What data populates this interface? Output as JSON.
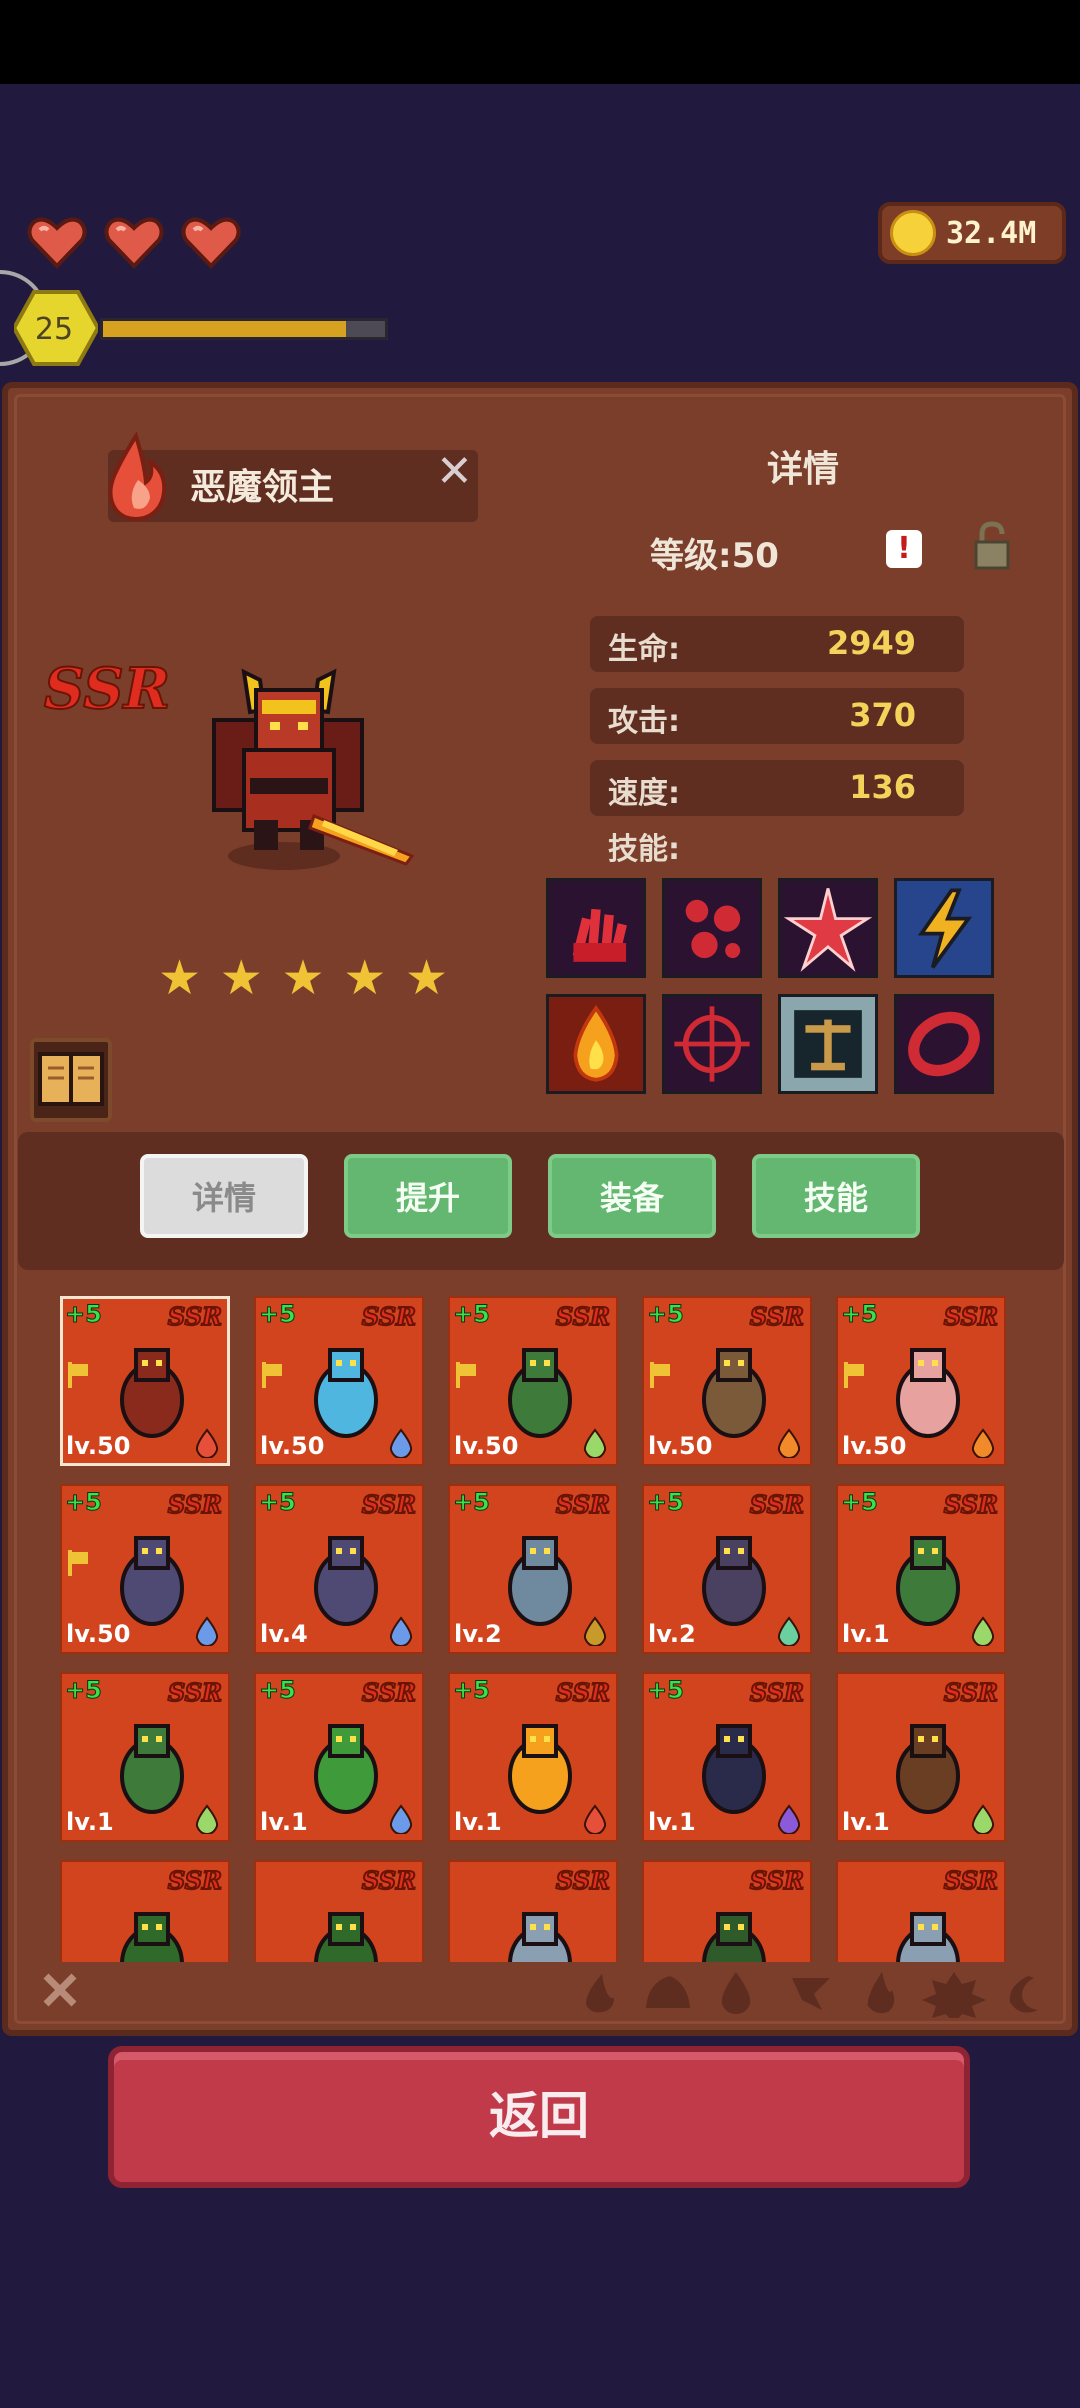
{
  "hud": {
    "hearts": 3,
    "coins": "32.4M",
    "player_level": "25",
    "xp_progress": 0.86
  },
  "hero": {
    "name": "恶魔领主",
    "rarity": "SSR",
    "stars": 5,
    "element": "fire"
  },
  "details": {
    "title": "详情",
    "level_text": "等级:50",
    "warn_glyph": "!",
    "stats": [
      {
        "label": "生命:",
        "value": "2949"
      },
      {
        "label": "攻击:",
        "value": "370"
      },
      {
        "label": "速度:",
        "value": "136"
      }
    ],
    "skills_label": "技能:",
    "skills": [
      "claw-skill-icon",
      "blood-drops-skill-icon",
      "star-burst-skill-icon",
      "lightning-skill-icon",
      "fire-skill-icon",
      "crosshair-skill-icon",
      "balance-skill-icon",
      "vortex-skill-icon"
    ]
  },
  "tabs": [
    {
      "label": "详情",
      "active": true
    },
    {
      "label": "提升",
      "active": false
    },
    {
      "label": "装备",
      "active": false
    },
    {
      "label": "技能",
      "active": false
    }
  ],
  "roster": [
    {
      "plus": "+5",
      "level": "lv.50",
      "flag": true,
      "element": "fire",
      "color": "#8a2a1c",
      "selected": true
    },
    {
      "plus": "+5",
      "level": "lv.50",
      "flag": true,
      "element": "water",
      "color": "#4fb6e0"
    },
    {
      "plus": "+5",
      "level": "lv.50",
      "flag": true,
      "element": "leaf",
      "color": "#3e7a3a"
    },
    {
      "plus": "+5",
      "level": "lv.50",
      "flag": true,
      "element": "sun",
      "color": "#7b5a3a"
    },
    {
      "plus": "+5",
      "level": "lv.50",
      "flag": true,
      "element": "sun",
      "color": "#e7a2a0"
    },
    {
      "plus": "+5",
      "level": "lv.50",
      "flag": true,
      "element": "water",
      "color": "#4e4a73"
    },
    {
      "plus": "+5",
      "level": "lv.4",
      "flag": false,
      "element": "water",
      "color": "#4e4a73"
    },
    {
      "plus": "+5",
      "level": "lv.2",
      "flag": false,
      "element": "earth",
      "color": "#6f8a9e"
    },
    {
      "plus": "+5",
      "level": "lv.2",
      "flag": false,
      "element": "wind",
      "color": "#4a4060"
    },
    {
      "plus": "+5",
      "level": "lv.1",
      "flag": false,
      "element": "leaf",
      "color": "#3e7a3a"
    },
    {
      "plus": "+5",
      "level": "lv.1",
      "flag": false,
      "element": "leaf",
      "color": "#3e7a3a"
    },
    {
      "plus": "+5",
      "level": "lv.1",
      "flag": false,
      "element": "water",
      "color": "#3f9a3a"
    },
    {
      "plus": "+5",
      "level": "lv.1",
      "flag": false,
      "element": "fire",
      "color": "#f6a11e"
    },
    {
      "plus": "+5",
      "level": "lv.1",
      "flag": false,
      "element": "moon",
      "color": "#2a2a4a"
    },
    {
      "plus": "",
      "level": "lv.1",
      "flag": false,
      "element": "leaf",
      "color": "#6a3e22"
    },
    {
      "plus": "",
      "level": "",
      "flag": false,
      "element": "",
      "color": "#2f6a2a"
    },
    {
      "plus": "",
      "level": "",
      "flag": false,
      "element": "",
      "color": "#2f6a2a"
    },
    {
      "plus": "",
      "level": "",
      "flag": false,
      "element": "",
      "color": "#8aa0b2"
    },
    {
      "plus": "",
      "level": "",
      "flag": false,
      "element": "",
      "color": "#2f5a2a"
    },
    {
      "plus": "",
      "level": "",
      "flag": false,
      "element": "",
      "color": "#8aa0b2"
    }
  ],
  "filters": [
    "clear-filter-icon",
    "fire-filter-icon",
    "earth-filter-icon",
    "water-filter-icon",
    "wind-filter-icon",
    "flame-filter-icon",
    "sun-filter-icon",
    "moon-filter-icon"
  ],
  "back_label": "返回",
  "colors": {
    "accent_green": "#63b770",
    "panel": "#7a3e2b",
    "back_button": "#c13a4a",
    "gold_text": "#f3d35a"
  }
}
